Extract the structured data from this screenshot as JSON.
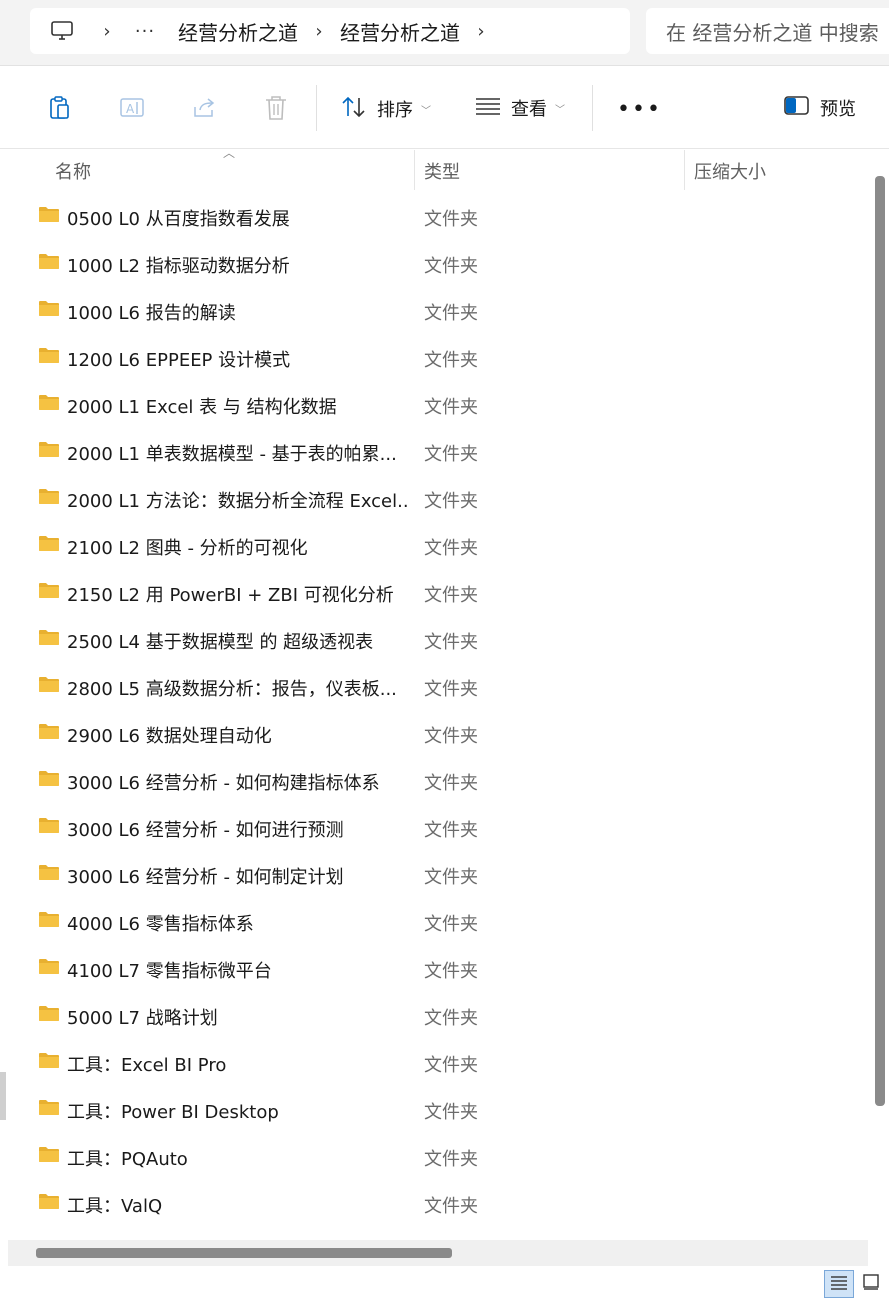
{
  "breadcrumb": {
    "items": [
      "经营分析之道",
      "经营分析之道"
    ]
  },
  "search": {
    "placeholder": "在 经营分析之道 中搜索"
  },
  "toolbar": {
    "sort_label": "排序",
    "view_label": "查看",
    "preview_label": "预览"
  },
  "columns": {
    "name": "名称",
    "type": "类型",
    "size": "压缩大小"
  },
  "files": [
    {
      "name": "0500 L0 从百度指数看发展",
      "type": "文件夹"
    },
    {
      "name": "1000 L2 指标驱动数据分析",
      "type": "文件夹"
    },
    {
      "name": "1000 L6 报告的解读",
      "type": "文件夹"
    },
    {
      "name": "1200 L6 EPPEEP 设计模式",
      "type": "文件夹"
    },
    {
      "name": "2000 L1 Excel 表 与 结构化数据",
      "type": "文件夹"
    },
    {
      "name": "2000 L1 单表数据模型 - 基于表的帕累...",
      "type": "文件夹"
    },
    {
      "name": "2000 L1 方法论：数据分析全流程 Excel...",
      "type": "文件夹"
    },
    {
      "name": "2100 L2 图典 - 分析的可视化",
      "type": "文件夹"
    },
    {
      "name": "2150 L2 用 PowerBI + ZBI 可视化分析",
      "type": "文件夹"
    },
    {
      "name": "2500 L4 基于数据模型 的 超级透视表",
      "type": "文件夹"
    },
    {
      "name": "2800 L5 高级数据分析：报告，仪表板...",
      "type": "文件夹"
    },
    {
      "name": "2900 L6 数据处理自动化",
      "type": "文件夹"
    },
    {
      "name": "3000 L6 经营分析 - 如何构建指标体系",
      "type": "文件夹"
    },
    {
      "name": "3000 L6 经营分析 - 如何进行预测",
      "type": "文件夹"
    },
    {
      "name": "3000 L6 经营分析 - 如何制定计划",
      "type": "文件夹"
    },
    {
      "name": "4000 L6 零售指标体系",
      "type": "文件夹"
    },
    {
      "name": "4100 L7 零售指标微平台",
      "type": "文件夹"
    },
    {
      "name": "5000 L7 战略计划",
      "type": "文件夹"
    },
    {
      "name": "工具：Excel BI Pro",
      "type": "文件夹"
    },
    {
      "name": "工具：Power BI Desktop",
      "type": "文件夹"
    },
    {
      "name": "工具：PQAuto",
      "type": "文件夹"
    },
    {
      "name": "工具：ValQ",
      "type": "文件夹"
    }
  ],
  "colors": {
    "folder": "#f5c242",
    "folder_tab": "#e8b030",
    "accent": "#0067c0"
  }
}
